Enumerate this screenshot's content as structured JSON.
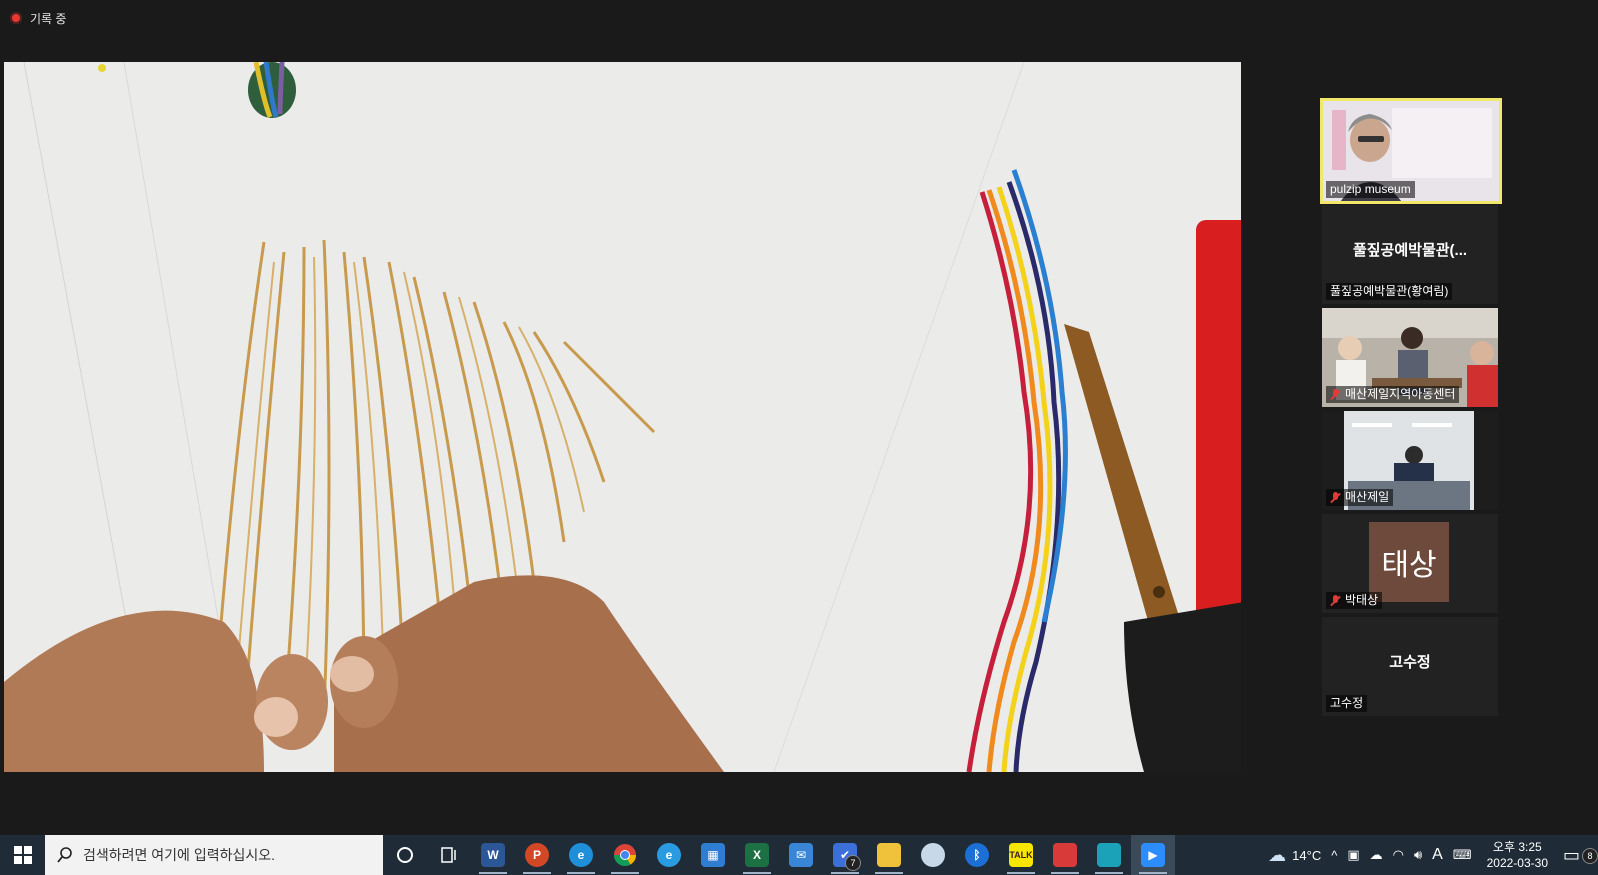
{
  "recording": {
    "label": "기록 중"
  },
  "main_video": {
    "description_icon": "video-feed"
  },
  "participants": [
    {
      "name": "pulzip museum",
      "active": true,
      "muted": false,
      "kind": "video"
    },
    {
      "name": "풀짚공예박물관(황여림)",
      "title": "풀짚공예박물관(...",
      "active": false,
      "muted": false,
      "kind": "name"
    },
    {
      "name": "매산제일지역아동센터",
      "active": false,
      "muted": true,
      "kind": "video"
    },
    {
      "name": "매산제일",
      "active": false,
      "muted": true,
      "kind": "video"
    },
    {
      "name": "박태상",
      "avatar_text": "태상",
      "active": false,
      "muted": true,
      "kind": "avatar"
    },
    {
      "name": "고수정",
      "title": "고수정",
      "active": false,
      "muted": false,
      "kind": "name"
    }
  ],
  "taskbar": {
    "search_placeholder": "검색하려면 여기에 입력하십시오.",
    "apps": [
      {
        "icon": "cortana-icon"
      },
      {
        "icon": "task-view-icon"
      },
      {
        "icon": "word-icon",
        "label": "W",
        "color": "#2b5797"
      },
      {
        "icon": "powerpoint-icon",
        "label": "P",
        "color": "#d24726"
      },
      {
        "icon": "edge-icon",
        "label": "e",
        "color": "#1e8fd8"
      },
      {
        "icon": "chrome-icon",
        "label": "",
        "color": "#db4437"
      },
      {
        "icon": "ie-icon",
        "label": "e",
        "color": "#2b9be1"
      },
      {
        "icon": "store-icon",
        "label": "",
        "color": "#2f7dd1"
      },
      {
        "icon": "excel-icon",
        "label": "X",
        "color": "#1d7044"
      },
      {
        "icon": "mail-icon",
        "label": "",
        "color": "#3a86d6"
      },
      {
        "icon": "todo-icon",
        "label": "✔",
        "color": "#3d6fd8",
        "badge": "7"
      },
      {
        "icon": "explorer-icon",
        "label": "",
        "color": "#f0c13b"
      },
      {
        "icon": "paint-icon",
        "label": "",
        "color": "#c7d9e8"
      },
      {
        "icon": "bluetooth-icon",
        "label": "",
        "color": "#1c6fd4"
      },
      {
        "icon": "kakaotalk-icon",
        "label": "TALK",
        "color": "#f7e600"
      },
      {
        "icon": "pdf-app-icon",
        "label": "",
        "color": "#d83a3a"
      },
      {
        "icon": "notepad-icon",
        "label": "",
        "color": "#1ba1b8"
      },
      {
        "icon": "zoom-icon",
        "label": "",
        "color": "#2d8cff"
      }
    ],
    "weather": "14°C",
    "time": "오후 3:25",
    "date": "2022-03-30",
    "ime": "A",
    "notifications": "8"
  }
}
